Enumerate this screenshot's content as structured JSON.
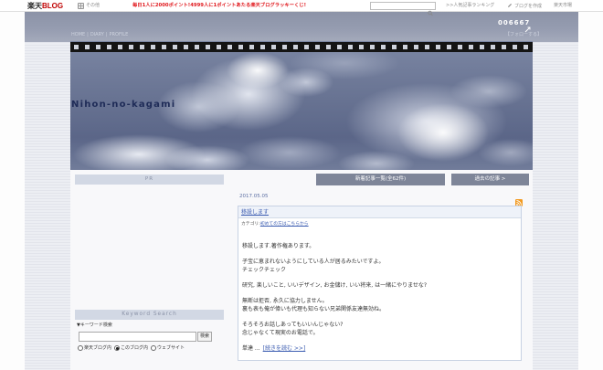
{
  "topbar": {
    "logo_brand": "楽天",
    "logo_blog": "BLOG",
    "other_icon": "apps-icon",
    "other_label": "その他",
    "campaign": "毎日1人に2000ポイント!4999人に1ポイントあたる楽天ブログラッキーくじ!",
    "search_value": "",
    "search_icon": "search-icon",
    "ranking_link": ">>人気記事ランキング",
    "create_icon": "pen-icon",
    "create_blog": "ブログを作成",
    "ichiba": "楽天市場"
  },
  "header": {
    "counter": "006667",
    "counter_icon": "expand-arrows-icon",
    "nav": [
      "HOME",
      "DIARY",
      "PROFILE"
    ],
    "nav_separator": "|",
    "follow": "【フォローする】",
    "blog_title": "Nihon-no-kagami"
  },
  "sidebar": {
    "pr_label": "PR",
    "keyword_title": "Keyword Search",
    "keyword_label": "▼キーワード検索",
    "search_value": "",
    "search_button": "検索",
    "scopes": [
      {
        "label": "楽天ブログ内",
        "checked": false
      },
      {
        "label": "このブログ内",
        "checked": true
      },
      {
        "label": "ウェブサイト",
        "checked": false
      }
    ]
  },
  "main": {
    "new_articles_button": "新着記事一覧(全62件)",
    "past_articles_button": "過去の記事 >",
    "date": "2017.05.05",
    "rss_icon": "rss-icon",
    "article": {
      "title": "移設します",
      "category_label": "カテゴリ:",
      "category": "初めての方はこちらから",
      "paragraphs": [
        [
          "移設します.著作権あります。"
        ],
        [
          "子宝に恵まれないようにしている人が居るみたいですよ。",
          "チェックチェック"
        ],
        [
          "研究, 楽しいこと, いいデザイン, お金儲け, いい将来, は一緒にやりませな?"
        ],
        [
          "無断は拒否, 永久に協力しません。",
          "裏も表も俺が偉いも代理も知らない兄弟関係友達無効ね。"
        ],
        [
          "そろそろお話しあってもいいんじゃない?",
          "念じゃなくて現実のお電話で。"
        ]
      ],
      "teaser": "単達 ...",
      "read_more": "[続きを読む >>]"
    }
  },
  "colors": {
    "brand_red": "#bf0000",
    "campaign_red": "#e0161b",
    "button": "#7e8598",
    "link": "#3a5bb0",
    "date": "#5c6fa3",
    "rss": "#f29a20",
    "bar": "#d2d8e4",
    "bar_text": "#8a92a7",
    "title": "#1e2b57"
  }
}
